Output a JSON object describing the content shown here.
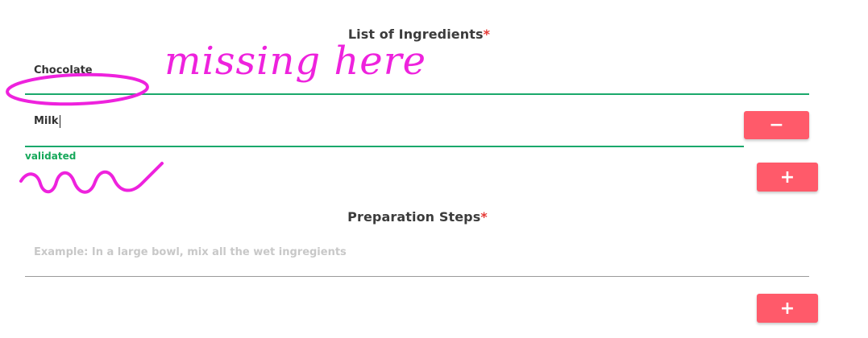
{
  "ingredients": {
    "title": "List of Ingredients",
    "required_mark": "*",
    "items": [
      {
        "value": "Chocolate"
      },
      {
        "value": "Milk"
      }
    ],
    "validation_message": "validated",
    "remove_button_label": "−",
    "add_button_label": "+"
  },
  "steps": {
    "title": "Preparation Steps",
    "required_mark": "*",
    "placeholder": "Example: In a large bowl, mix all the wet ingregients",
    "add_button_label": "+"
  },
  "annotations": {
    "handwritten_note": "missing here",
    "marker_color": "#ee22dd"
  },
  "colors": {
    "accent_button": "#ff5a6a",
    "valid_line": "#1aa86b",
    "required_star": "#e53935"
  }
}
